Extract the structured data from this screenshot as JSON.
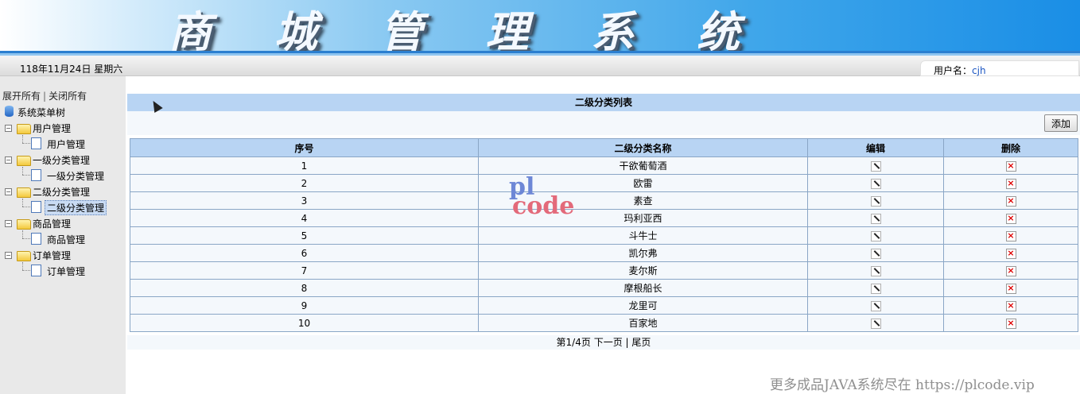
{
  "header": {
    "title": "商 城 管 理 系 统"
  },
  "infobar": {
    "date": "118年11月24日 星期六",
    "user_label": "用户名：",
    "username": "cjh"
  },
  "sidebar": {
    "expand_all": "展开所有",
    "separator": "|",
    "collapse_all": "关闭所有",
    "root": "系统菜单树",
    "groups": [
      {
        "label": "用户管理",
        "child": "用户管理"
      },
      {
        "label": "一级分类管理",
        "child": "一级分类管理"
      },
      {
        "label": "二级分类管理",
        "child": "二级分类管理"
      },
      {
        "label": "商品管理",
        "child": "商品管理"
      },
      {
        "label": "订单管理",
        "child": "订单管理"
      }
    ]
  },
  "main": {
    "title": "二级分类列表",
    "add_label": "添加",
    "columns": [
      "序号",
      "二级分类名称",
      "编辑",
      "删除"
    ],
    "rows": [
      {
        "no": "1",
        "name": "干欲葡萄酒"
      },
      {
        "no": "2",
        "name": "欧雷"
      },
      {
        "no": "3",
        "name": "素查"
      },
      {
        "no": "4",
        "name": "玛利亚西"
      },
      {
        "no": "5",
        "name": "斗牛士"
      },
      {
        "no": "6",
        "name": "凯尔弗"
      },
      {
        "no": "7",
        "name": "麦尔斯"
      },
      {
        "no": "8",
        "name": "摩根船长"
      },
      {
        "no": "9",
        "name": "龙里可"
      },
      {
        "no": "10",
        "name": "百家地"
      }
    ],
    "pager": {
      "page_info": "第1/4页",
      "next": "下一页",
      "separator": "|",
      "last": "尾页"
    }
  },
  "watermark": {
    "logo_top": "pl",
    "logo_bottom": "code",
    "note": "更多成品JAVA系统尽在 https://plcode.vip"
  },
  "colors": {
    "header_blue": "#1a8ee6",
    "table_header": "#b8d4f3",
    "link_blue": "#1b56c2",
    "delete_red": "#dd0000"
  }
}
